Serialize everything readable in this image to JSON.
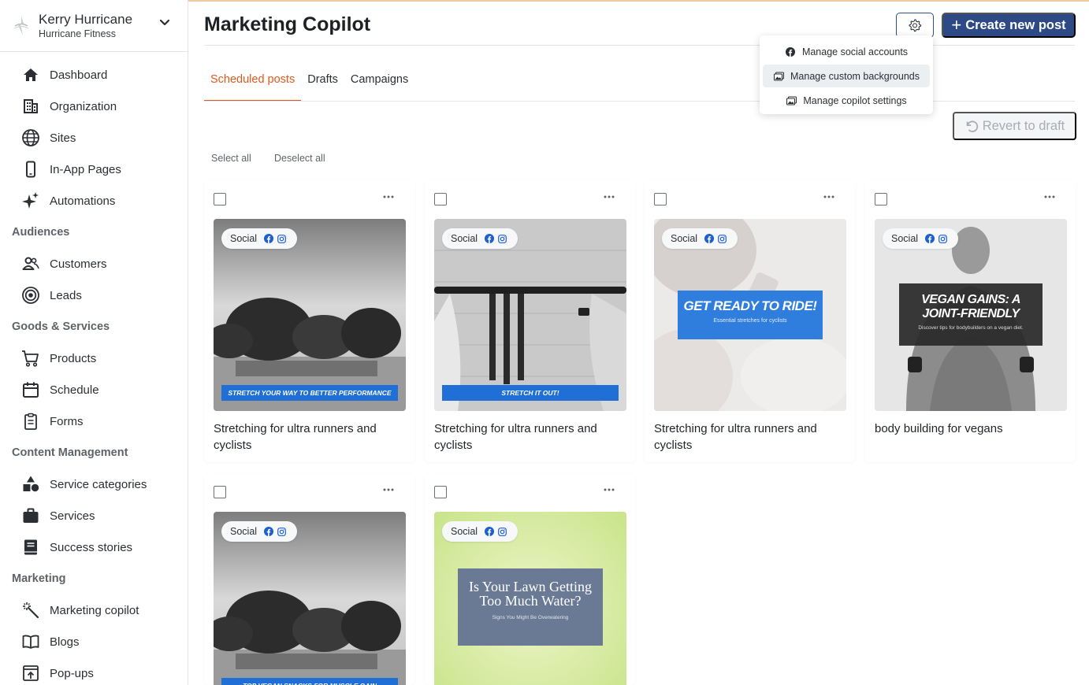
{
  "account": {
    "name": "Kerry Hurricane",
    "org": "Hurricane Fitness"
  },
  "nav": {
    "top": [
      {
        "label": "Dashboard",
        "icon": "home-icon"
      },
      {
        "label": "Organization",
        "icon": "building-icon"
      },
      {
        "label": "Sites",
        "icon": "globe-icon"
      },
      {
        "label": "In-App Pages",
        "icon": "phone-icon"
      },
      {
        "label": "Automations",
        "icon": "sparkle-icon"
      }
    ],
    "audiences_label": "Audiences",
    "audiences": [
      {
        "label": "Customers",
        "icon": "users-icon"
      },
      {
        "label": "Leads",
        "icon": "target-icon"
      }
    ],
    "goods_label": "Goods & Services",
    "goods": [
      {
        "label": "Products",
        "icon": "cart-icon"
      },
      {
        "label": "Schedule",
        "icon": "calendar-icon"
      },
      {
        "label": "Forms",
        "icon": "clipboard-icon"
      }
    ],
    "content_label": "Content Management",
    "content": [
      {
        "label": "Service categories",
        "icon": "shapes-icon"
      },
      {
        "label": "Services",
        "icon": "briefcase-icon"
      },
      {
        "label": "Success stories",
        "icon": "book-icon"
      }
    ],
    "marketing_label": "Marketing",
    "marketing": [
      {
        "label": "Marketing copilot",
        "icon": "magic-wand-icon"
      },
      {
        "label": "Blogs",
        "icon": "open-book-icon"
      },
      {
        "label": "Pop-ups",
        "icon": "popup-icon"
      }
    ]
  },
  "header": {
    "title": "Marketing Copilot",
    "create_label": "Create new post"
  },
  "settings_menu": [
    "Manage social accounts",
    "Manage custom backgrounds",
    "Manage copilot settings"
  ],
  "tabs": [
    "Scheduled posts",
    "Drafts",
    "Campaigns"
  ],
  "revert_label": "Revert to draft",
  "select_all": "Select all",
  "deselect_all": "Deselect all",
  "chip_label": "Social",
  "posts": [
    {
      "title": "Stretching for ultra runners and cyclists",
      "banner": "STRETCH YOUR WAY TO BETTER PERFORMANCE"
    },
    {
      "title": "Stretching for ultra runners and cyclists",
      "banner": "STRETCH IT OUT!"
    },
    {
      "title": "Stretching for ultra runners and cyclists",
      "banner": "GET READY TO RIDE!",
      "sub": "Essential stretches for cyclists"
    },
    {
      "title": "body building for vegans",
      "banner": "VEGAN GAINS: A JOINT-FRIENDLY",
      "sub": "Discover tips for bodybuilders on a vegan diet."
    },
    {
      "title": "",
      "banner": "TOP VEGAN SNACKS FOR MUSCLE GAIN"
    },
    {
      "title": "",
      "banner": "Is Your Lawn Getting Too Much Water?",
      "sub": "Signs You Might Be Overwatering"
    }
  ],
  "colors": {
    "accent": "#e0591c",
    "primary": "#2e4a86",
    "banner_blue": "#1f6fd6"
  }
}
